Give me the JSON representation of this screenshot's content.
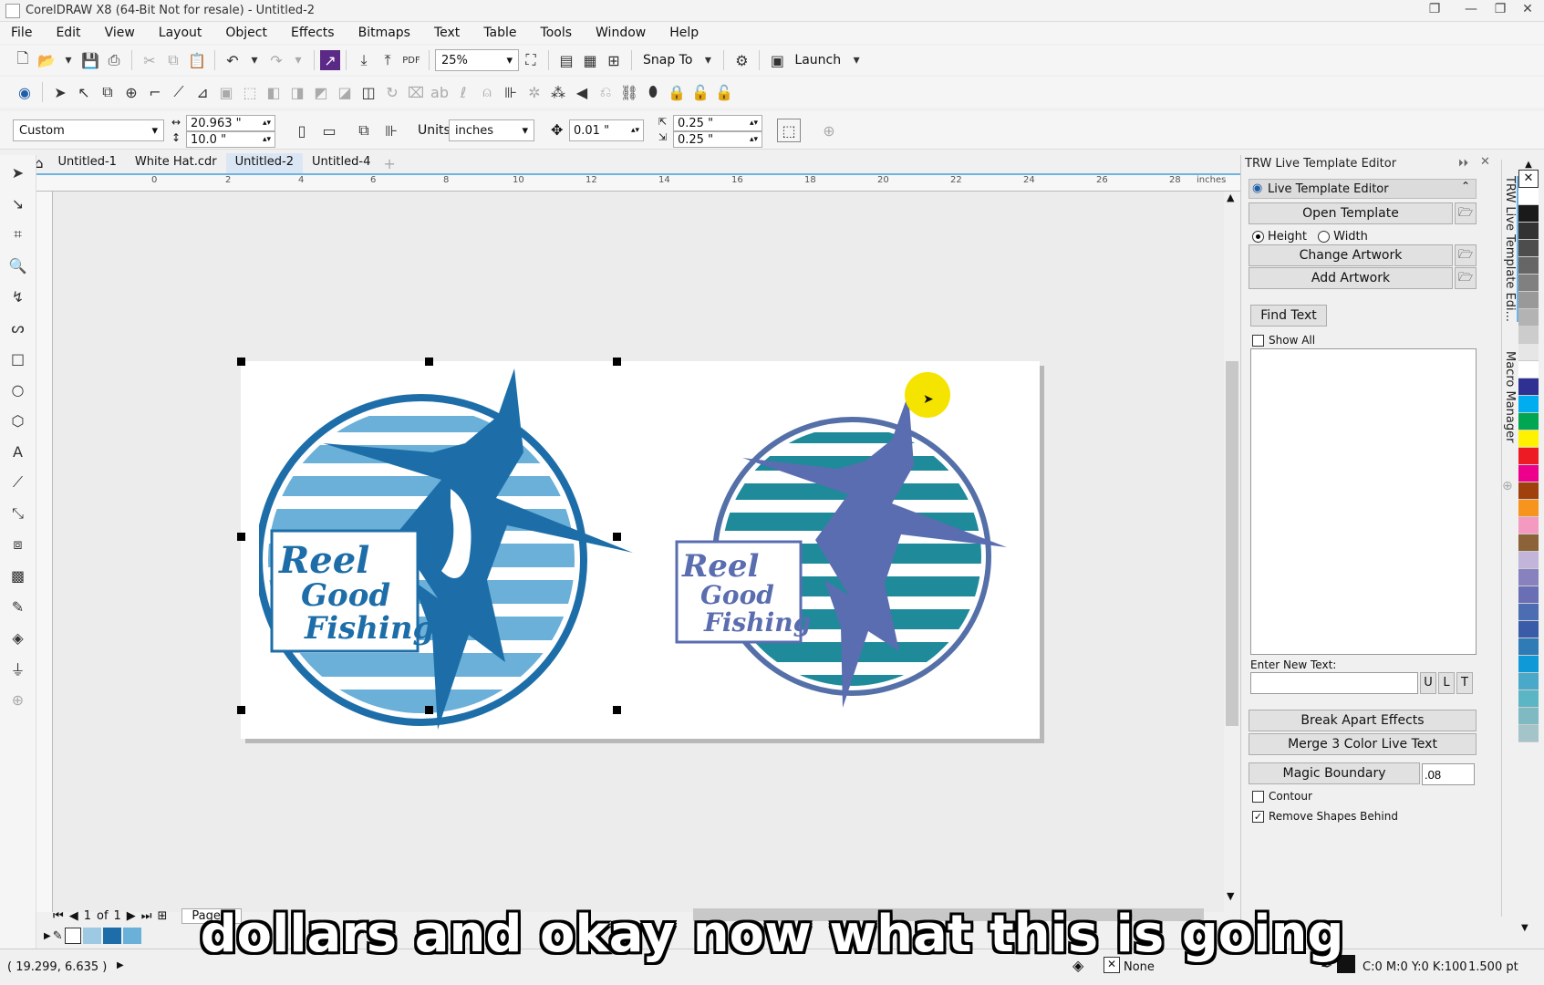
{
  "window": {
    "title": "CorelDRAW X8 (64-Bit Not for resale) - Untitled-2"
  },
  "menu": [
    "File",
    "Edit",
    "View",
    "Layout",
    "Object",
    "Effects",
    "Bitmaps",
    "Text",
    "Table",
    "Tools",
    "Window",
    "Help"
  ],
  "toolbar": {
    "zoom": "25%",
    "snap_to": "Snap To",
    "launch": "Launch"
  },
  "propbar": {
    "preset": "Custom",
    "width": "20.963 \"",
    "height": "10.0 \"",
    "units_label": "Units:",
    "units": "inches",
    "nudge": "0.01 \"",
    "dup_x": "0.25 \"",
    "dup_y": "0.25 \""
  },
  "doc_tabs": [
    "Untitled-1",
    "White Hat.cdr",
    "Untitled-2",
    "Untitled-4"
  ],
  "ruler": {
    "marks": [
      "0",
      "2",
      "4",
      "6",
      "8",
      "10",
      "12",
      "14",
      "16",
      "18",
      "20",
      "22",
      "24",
      "26",
      "28"
    ],
    "unit": "inches"
  },
  "artwork": {
    "left_text": [
      "Reel",
      "Good",
      "Fishing"
    ],
    "right_text": [
      "Reel",
      "Good",
      "Fishing"
    ]
  },
  "page_nav": {
    "current": "1",
    "of_label": "of",
    "total": "1",
    "page_tab": "Page 1"
  },
  "docker": {
    "header": "TRW Live Template Editor",
    "panel_title": "Live Template Editor",
    "open_template": "Open Template",
    "radio_height": "Height",
    "radio_width": "Width",
    "change_artwork": "Change Artwork",
    "add_artwork": "Add Artwork",
    "find_text": "Find Text",
    "show_all": "Show All",
    "enter_new_text": "Enter New Text:",
    "case_u": "U",
    "case_l": "L",
    "case_t": "T",
    "break_apart": "Break Apart Effects",
    "merge": "Merge 3 Color Live Text",
    "magic_boundary": "Magic Boundary",
    "magic_value": ".08",
    "contour": "Contour",
    "remove_shapes": "Remove Shapes Behind",
    "side_tab_1": "TRW Live Template Edi...",
    "side_tab_2": "Macro Manager"
  },
  "status": {
    "coords": "( 19.299, 6.635 )",
    "fill_none": "None",
    "color": "C:0 M:0 Y:0 K:100",
    "stroke": "1.500 pt"
  },
  "subtitle": "dollars and okay now what this is going",
  "palette": [
    "#ffffff",
    "#1a1a1a",
    "#333333",
    "#4d4d4d",
    "#666666",
    "#808080",
    "#999999",
    "#b3b3b3",
    "#cccccc",
    "#e6e6e6",
    "#ffffff",
    "#2e3192",
    "#00aeef",
    "#00a651",
    "#fff200",
    "#ed1c24",
    "#ec008c",
    "#a0410d",
    "#f7941d",
    "#f49ac1",
    "#8c6239",
    "#c2b5d9",
    "#8781bd",
    "#6a6fb5",
    "#4d6db3",
    "#3a5ca8",
    "#2e7bb6",
    "#0f99d6",
    "#4aa8c8",
    "#5bb5c4",
    "#7fb9c2",
    "#a3c4c8"
  ]
}
